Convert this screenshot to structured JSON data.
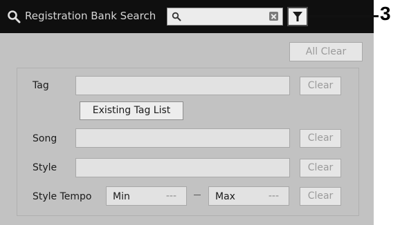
{
  "header": {
    "title": "Registration Bank Search",
    "search_placeholder": "",
    "search_icon": "search-icon",
    "clear_icon": "clear-field-icon",
    "filter_icon": "filter-icon",
    "callout_number": "3"
  },
  "actions": {
    "all_clear_label": "All Clear"
  },
  "fields": {
    "tag": {
      "label": "Tag",
      "clear_label": "Clear",
      "existing_tag_list_label": "Existing Tag List"
    },
    "song": {
      "label": "Song",
      "clear_label": "Clear"
    },
    "style": {
      "label": "Style",
      "clear_label": "Clear"
    },
    "style_tempo": {
      "label": "Style Tempo",
      "min_label": "Min",
      "min_value": "---",
      "max_label": "Max",
      "max_value": "---",
      "clear_label": "Clear"
    }
  },
  "colors": {
    "titlebar": "#0f0f0f",
    "panel": "#c2c2c2",
    "field": "#e2e2e2",
    "button": "#e6e6e6"
  }
}
